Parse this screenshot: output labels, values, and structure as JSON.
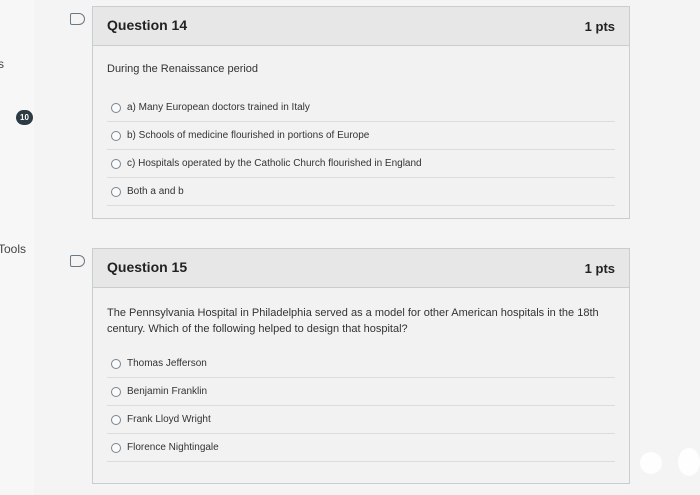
{
  "sidebar": {
    "partial_label": "s",
    "badge": "10",
    "tools_label": "Tools"
  },
  "questions": [
    {
      "title": "Question 14",
      "points": "1 pts",
      "text": "During the Renaissance period",
      "answers": [
        "a) Many European doctors trained in Italy",
        "b) Schools of medicine flourished in portions of Europe",
        "c) Hospitals operated by the Catholic Church flourished in England",
        "Both a and b"
      ]
    },
    {
      "title": "Question 15",
      "points": "1 pts",
      "text": "The Pennsylvania Hospital in Philadelphia served as a model for other American hospitals in the 18th century. Which of the following helped to design that hospital?",
      "answers": [
        "Thomas Jefferson",
        "Benjamin Franklin",
        "Frank Lloyd Wright",
        "Florence Nightingale"
      ]
    }
  ]
}
